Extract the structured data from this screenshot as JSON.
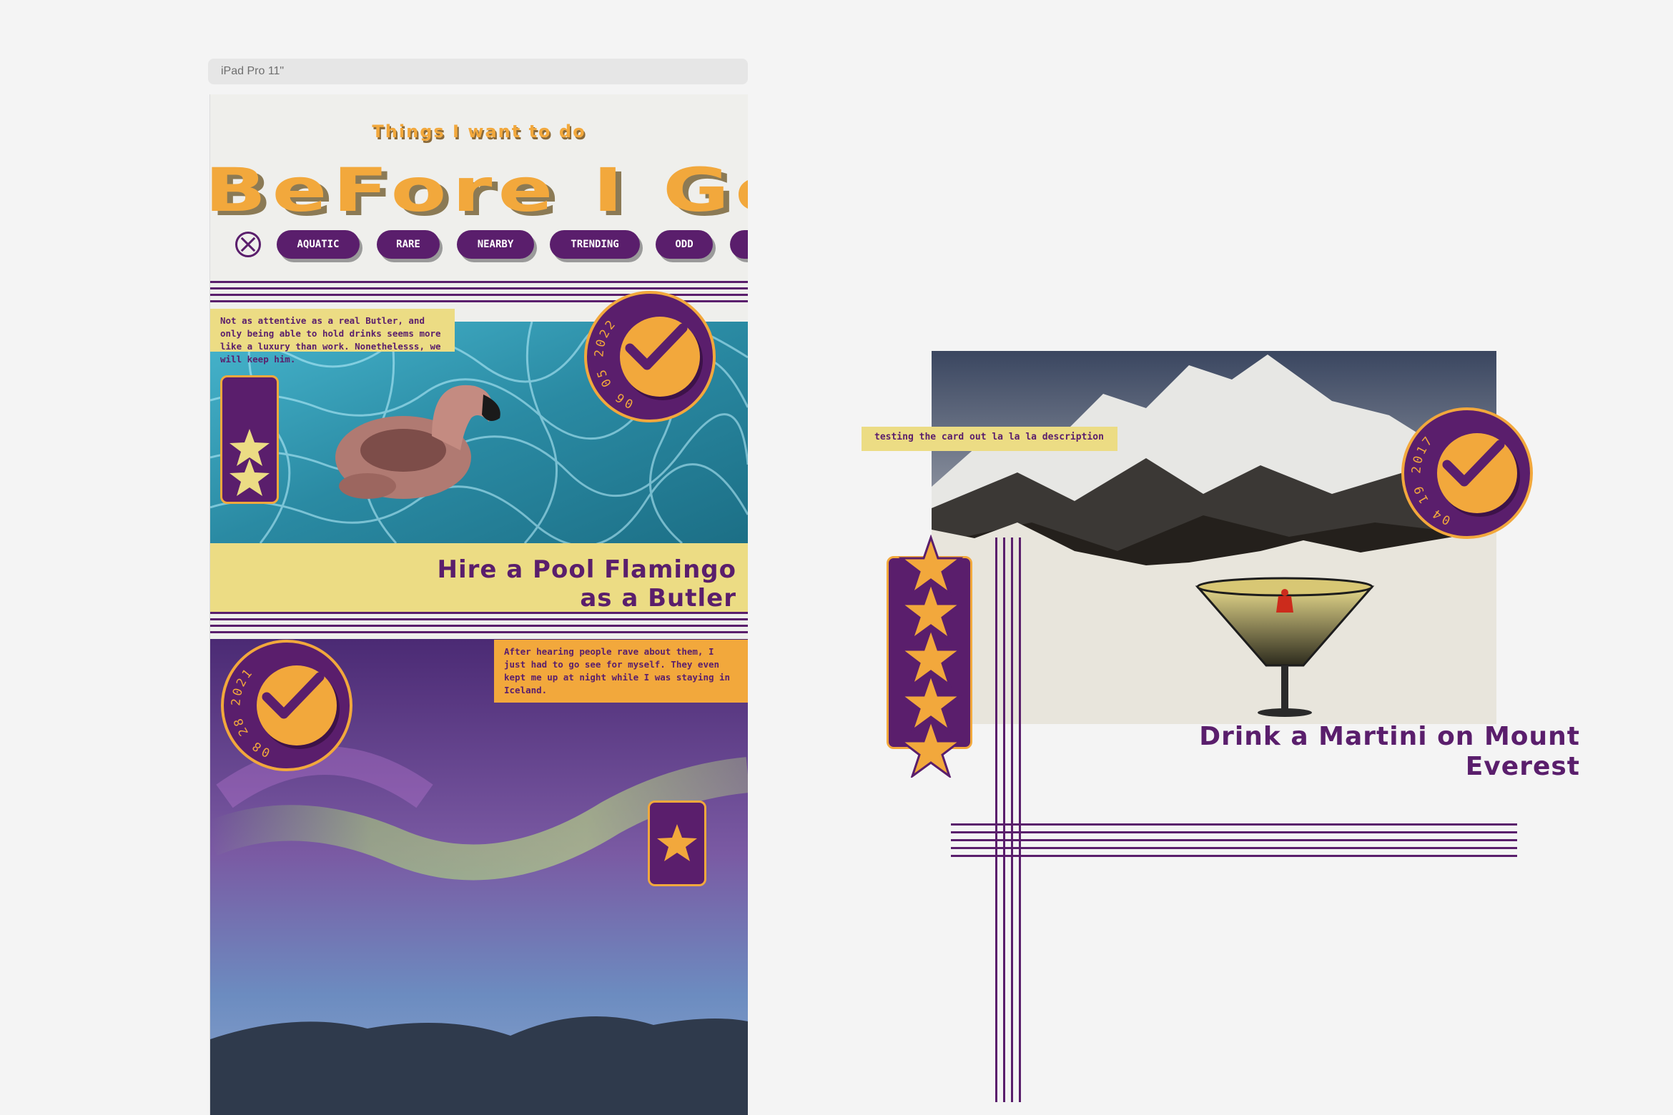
{
  "frame": {
    "label": "iPad Pro 11\""
  },
  "header": {
    "subtitle": "Things I want to do",
    "title": "BeFore I Go"
  },
  "filters": {
    "clear_icon": "clear-x-icon",
    "chips": [
      "AQUATIC",
      "RARE",
      "NEARBY",
      "TRENDING",
      "ODD"
    ]
  },
  "cards": [
    {
      "description": "Not as attentive as a real Butler, and only being able to hold drinks seems more like a luxury than work. Nonethelesss, we will keep him.",
      "date": "06 05 2022",
      "title_line1": "Hire a Pool Flamingo",
      "title_line2": "as a Butler",
      "stars": 2
    },
    {
      "description": "After hearing people rave about them, I just had to go see for myself. They even kept me up at night while I was staying in Iceland.",
      "date": "08 28 2021",
      "stars": 1
    }
  ],
  "preview_card": {
    "description": "testing the card out la la la description",
    "date": "04 19 2017",
    "title_line1": "Drink a Martini on Mount",
    "title_line2": "Everest",
    "stars": 5
  },
  "colors": {
    "purple": "#5a1e6c",
    "orange": "#f2a83c",
    "yellow": "#ecdc84",
    "background": "#f4f4f4"
  }
}
